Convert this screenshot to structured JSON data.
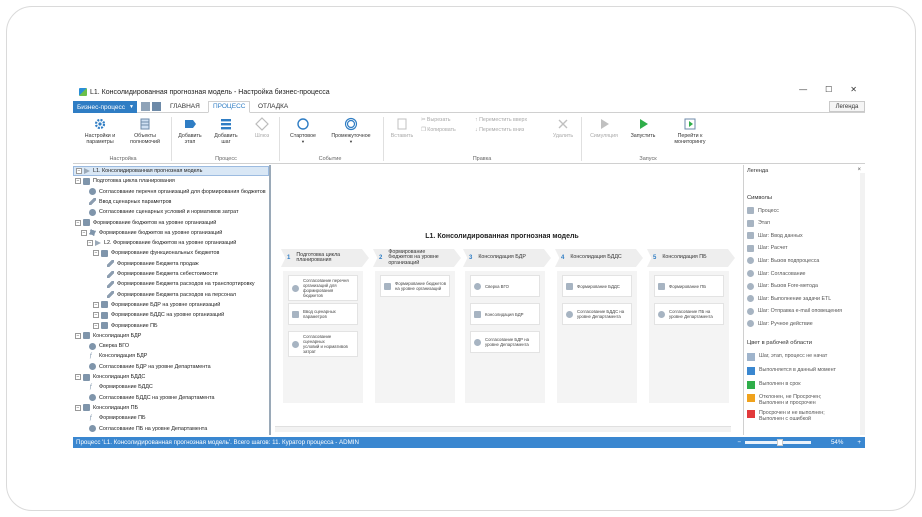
{
  "window": {
    "title": "L1. Консолидированная прогнозная модель - Настройка бизнес-процесса",
    "minimize": "—",
    "maximize": "☐",
    "close": "✕"
  },
  "tabs": {
    "dropdown": "Бизнес-процесс",
    "items": [
      "ГЛАВНАЯ",
      "ПРОЦЕСС",
      "ОТЛАДКА"
    ],
    "active": "ПРОЦЕСС",
    "legend_button": "Легенда"
  },
  "ribbon": {
    "settings_params": "Настройки и\nпараметры",
    "objects_full": "Объекты\nполномочий",
    "add_stage": "Добавить\nэтап",
    "add_step": "Добавить\nшаг",
    "gateway": "Шлюз",
    "start": "Стартовое",
    "intermediate": "Промежуточное",
    "insert": "Вставить",
    "cut": "Вырезать",
    "copy": "Копировать",
    "move_up": "Переместить вверх",
    "move_down": "Переместить вниз",
    "delete": "Удалить",
    "simulate": "Симуляция",
    "run": "Запустить",
    "go_monitor": "Перейти к\nмониторингу",
    "groups": {
      "settings": "Настройка",
      "process": "Процесс",
      "event": "Событие",
      "edit": "Правка",
      "launch": "Запуск"
    }
  },
  "tree": [
    {
      "label": "L1. Консолидированная прогнозная модель",
      "icon": "triangle",
      "level": 0,
      "selected": true
    },
    {
      "label": "Подготовка цикла планирования",
      "icon": "folder",
      "level": 0
    },
    {
      "label": "Согласование перечня организаций для формирования бюджетов",
      "icon": "user",
      "level": 1
    },
    {
      "label": "Ввод сценарных параметров",
      "icon": "pen",
      "level": 1
    },
    {
      "label": "Согласование сценарных условий и нормативов затрат",
      "icon": "user",
      "level": 1
    },
    {
      "label": "Формирование бюджетов на уровне организаций",
      "icon": "folder",
      "level": 0
    },
    {
      "label": "Формирование бюджетов на уровне организаций",
      "icon": "gear",
      "level": 1
    },
    {
      "label": "L2. Формирование бюджетов на уровне организаций",
      "icon": "triangle",
      "level": 2
    },
    {
      "label": "Формирование функциональных бюджетов",
      "icon": "folder",
      "level": 3
    },
    {
      "label": "Формирование Бюджета продаж",
      "icon": "pen",
      "level": 4
    },
    {
      "label": "Формирование Бюджета себестоимости",
      "icon": "pen",
      "level": 4
    },
    {
      "label": "Формирование Бюджета расходов на транспортировку",
      "icon": "pen",
      "level": 4
    },
    {
      "label": "Формирование Бюджета расходов на персонал",
      "icon": "pen",
      "level": 4
    },
    {
      "label": "Формирование БДР на уровне организаций",
      "icon": "folder",
      "level": 3
    },
    {
      "label": "Формирование БДДС на уровне организаций",
      "icon": "folder",
      "level": 3
    },
    {
      "label": "Формирование ПБ",
      "icon": "folder",
      "level": 3
    },
    {
      "label": "Консолидация БДР",
      "icon": "folder",
      "level": 0
    },
    {
      "label": "Сверка ВГО",
      "icon": "user",
      "level": 1
    },
    {
      "label": "Консолидация БДР",
      "icon": "fx",
      "level": 1
    },
    {
      "label": "Согласование БДР на уровне Департамента",
      "icon": "user",
      "level": 1
    },
    {
      "label": "Консолидация БДДС",
      "icon": "folder",
      "level": 0
    },
    {
      "label": "Формирование БДДС",
      "icon": "fx",
      "level": 1
    },
    {
      "label": "Согласование БДДС на уровне Департамента",
      "icon": "user",
      "level": 1
    },
    {
      "label": "Консолидация ПБ",
      "icon": "folder",
      "level": 0
    },
    {
      "label": "Формирование ПБ",
      "icon": "fx",
      "level": 1
    },
    {
      "label": "Согласование ПБ на уровне Департамента",
      "icon": "user",
      "level": 1
    }
  ],
  "diagram": {
    "title": "L1. Консолидированная прогнозная модель",
    "stages": [
      {
        "num": "1",
        "label": "Подготовка цикла\nпланирования"
      },
      {
        "num": "2",
        "label": "Формирование\nбюджетов на уровне\nорганизаций"
      },
      {
        "num": "3",
        "label": "Консолидация БДР"
      },
      {
        "num": "4",
        "label": "Консолидация БДДС"
      },
      {
        "num": "5",
        "label": "Консолидация ПБ"
      }
    ],
    "cards": [
      [
        "Согласование перечня\nорганизаций для\nформирования бюджетов",
        "Ввод сценарных\nпараметров",
        "Согласование сценарных\nусловий и нормативов\nзатрат"
      ],
      [
        "Формирование бюджетов\nна уровне организаций"
      ],
      [
        "Сверка ВГО",
        "Консолидация БДР",
        "Согласование БДР на\nуровне Департамента"
      ],
      [
        "Формирование БДДС",
        "Согласование БДДС на\nуровне Департамента"
      ],
      [
        "Формирование ПБ",
        "Согласование ПБ на\nуровне Департамента"
      ]
    ]
  },
  "legend": {
    "title": "Легенда",
    "close": "×",
    "symbols_title": "Символы",
    "symbols": [
      "Процесс",
      "Этап",
      "Шаг: Ввод данных",
      "Шаг: Расчет",
      "Шаг: Вызов подпроцесса",
      "Шаг: Согласование",
      "Шаг: Вызов Fore-метода",
      "Шаг: Выполнение задачи ETL",
      "Шаг: Отправка e-mail оповещения",
      "Шаг: Ручное действие"
    ],
    "colors_title": "Цвет в рабочей области",
    "colors": [
      {
        "label": "Шаг, этап, процесс не начат",
        "color": "#9fb4cc"
      },
      {
        "label": "Выполняется в данный момент",
        "color": "#3a87d0"
      },
      {
        "label": "Выполнен в срок",
        "color": "#2fae4a"
      },
      {
        "label": "Отклонен, не Просрочен;\nВыполнен и просрочен",
        "color": "#f0a21c"
      },
      {
        "label": "Просрочен и не выполнен;\nВыполнен с ошибкой",
        "color": "#e2393b"
      }
    ]
  },
  "status": {
    "text": "Процесс 'L1. Консолидированная прогнозная модель'. Всего шагов: 11. Куратор процесса - ADMIN",
    "zoom": "54%",
    "zoom_out": "−",
    "zoom_in": "+"
  }
}
